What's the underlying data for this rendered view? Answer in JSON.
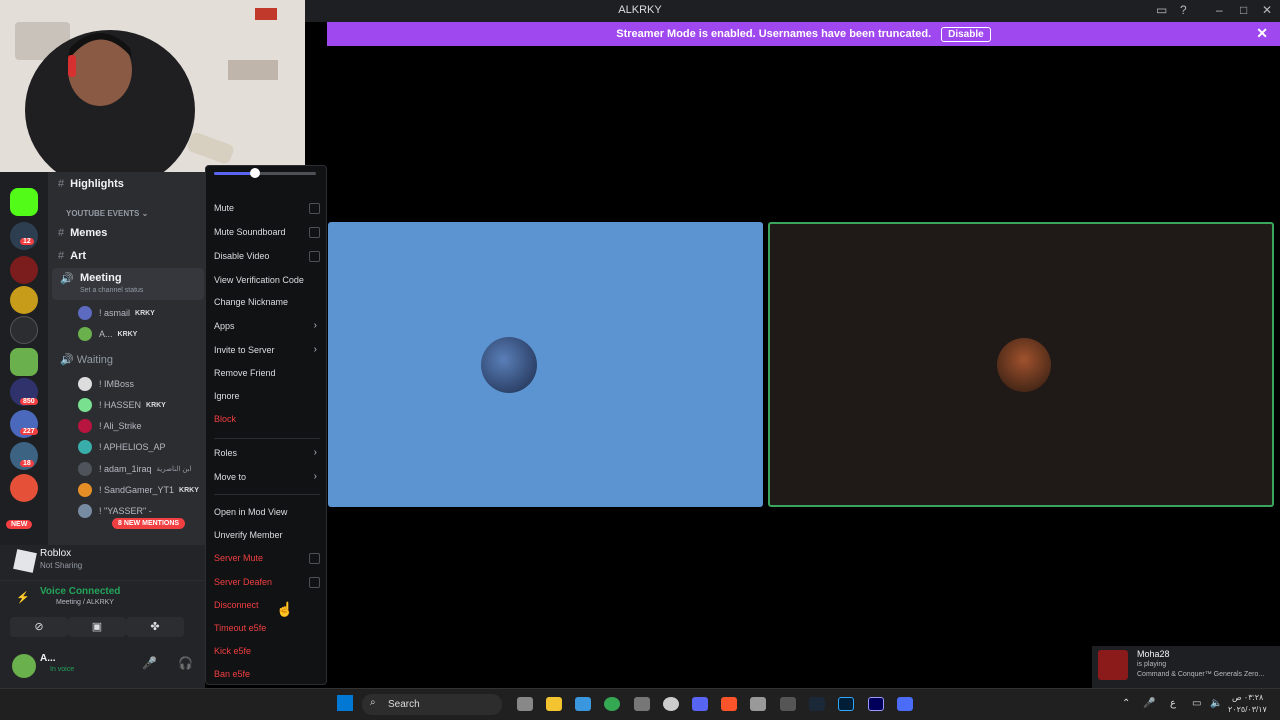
{
  "window": {
    "title": "ALKRKY"
  },
  "banner": {
    "text": "Streamer Mode is enabled. Usernames have been truncated.",
    "button": "Disable"
  },
  "server_rail": {
    "badges": [
      "12",
      "850",
      "227",
      "18"
    ],
    "new_label": "NEW"
  },
  "sidebar": {
    "text_channels": [
      {
        "name": "Highlights"
      },
      {
        "name": "Memes"
      },
      {
        "name": "Art"
      }
    ],
    "category": "YOUTUBE EVENTS",
    "voice_meeting": {
      "name": "Meeting",
      "status_hint": "Set a channel status",
      "users": [
        {
          "name": "! asmail",
          "tag": "KRKY"
        },
        {
          "name": "A...",
          "tag": "KRKY"
        }
      ]
    },
    "voice_waiting": {
      "name": "Waiting",
      "users": [
        {
          "name": "! IMBoss",
          "tag": ""
        },
        {
          "name": "! HASSEN",
          "tag": "KRKY"
        },
        {
          "name": "! Ali_Strike",
          "tag": ""
        },
        {
          "name": "! APHELIOS_AP",
          "tag": ""
        },
        {
          "name": "! adam_1iraq",
          "tag": "ابن الناصرية"
        },
        {
          "name": "! SandGamer_YT1",
          "tag": "KRKY"
        },
        {
          "name": "! \"YASSER\" -",
          "tag": ""
        }
      ]
    },
    "mentions_pill": "8 NEW MENTIONS"
  },
  "activity": {
    "game": "Roblox",
    "status": "Not Sharing"
  },
  "voice_panel": {
    "status": "Voice Connected",
    "channel": "Meeting / ALKRKY"
  },
  "user_panel": {
    "name": "A...",
    "status": "In voice"
  },
  "context_menu": {
    "items": [
      {
        "label": "Mute",
        "kind": "check",
        "color": "normal"
      },
      {
        "label": "Mute Soundboard",
        "kind": "check",
        "color": "normal"
      },
      {
        "label": "Disable Video",
        "kind": "check",
        "color": "normal"
      },
      {
        "label": "View Verification Code",
        "kind": "plain",
        "color": "normal"
      },
      {
        "label": "Change Nickname",
        "kind": "plain",
        "color": "normal"
      },
      {
        "label": "Apps",
        "kind": "submenu",
        "color": "normal"
      },
      {
        "label": "Invite to Server",
        "kind": "submenu",
        "color": "normal"
      },
      {
        "label": "Remove Friend",
        "kind": "plain",
        "color": "normal"
      },
      {
        "label": "Ignore",
        "kind": "plain",
        "color": "normal"
      },
      {
        "label": "Block",
        "kind": "plain",
        "color": "red"
      },
      {
        "label": "Roles",
        "kind": "submenu",
        "color": "normal"
      },
      {
        "label": "Move to",
        "kind": "submenu",
        "color": "normal"
      },
      {
        "label": "Open in Mod View",
        "kind": "plain",
        "color": "normal"
      },
      {
        "label": "Unverify Member",
        "kind": "plain",
        "color": "normal"
      },
      {
        "label": "Server Mute",
        "kind": "check",
        "color": "red"
      },
      {
        "label": "Server Deafen",
        "kind": "check",
        "color": "red"
      },
      {
        "label": "Disconnect",
        "kind": "plain",
        "color": "red"
      },
      {
        "label": "Timeout e5fe",
        "kind": "plain",
        "color": "red"
      },
      {
        "label": "Kick e5fe",
        "kind": "plain",
        "color": "red"
      },
      {
        "label": "Ban e5fe",
        "kind": "plain",
        "color": "red"
      }
    ]
  },
  "toast": {
    "user": "Moha28",
    "line1": "is playing",
    "line2": "Command & Conquer™ Generals Zero..."
  },
  "taskbar": {
    "search": "Search",
    "lang": "ع",
    "time": "٠٣:٢٨ ص",
    "date": "٢٠٢٥/٠٣/١٧"
  },
  "colors": {
    "banner": "#a048f0",
    "tile_blue": "#5b94d1",
    "speaking": "#3ba55d",
    "danger": "#f23f42",
    "online": "#23a55a"
  }
}
